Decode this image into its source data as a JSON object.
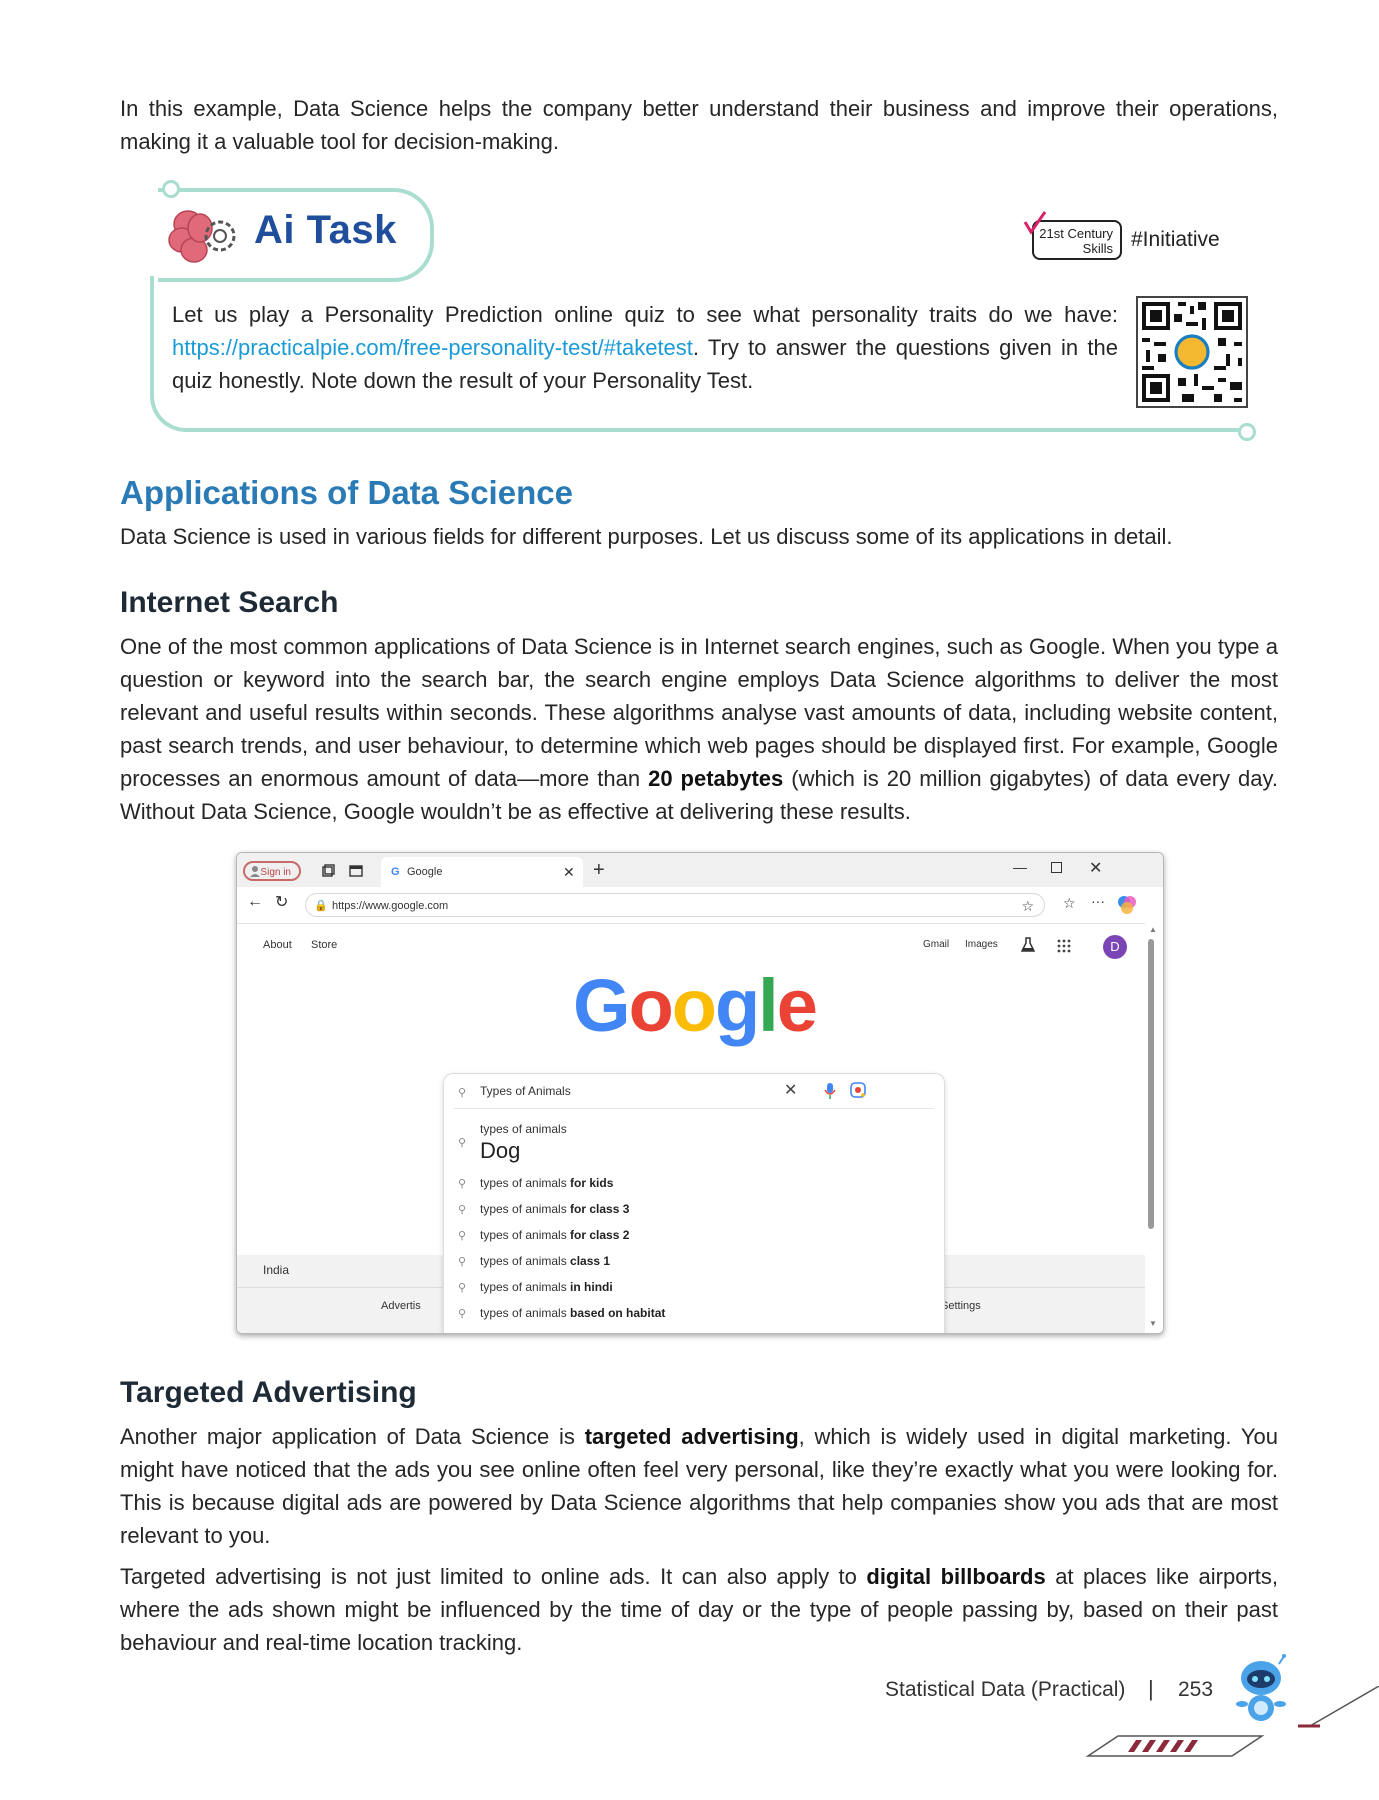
{
  "intro": {
    "text": "In this example, Data Science helps the company better understand their business and improve their operations, making it a valuable tool for decision-making."
  },
  "ai_task": {
    "title": "Ai Task",
    "badge_line1": "21st Century",
    "badge_line2": "Skills",
    "initiative": "#Initiative",
    "text_before": "Let us play a Personality Prediction online quiz to see what personality traits do we have: ",
    "link": "https://practicalpie.com/free-personality-test/#taketest",
    "text_after": ". Try to answer the questions given in the quiz honestly. Note down the result of your Personality Test."
  },
  "applications": {
    "heading": "Applications of Data Science",
    "text": "Data Science is used in various fields for different purposes. Let us discuss some of its applications in detail."
  },
  "internet_search": {
    "heading": "Internet Search",
    "text_1": "One of the most common applications of Data Science is in Internet search engines, such as Google. When you type a question or keyword into the search bar, the search engine employs Data Science algorithms to deliver the most relevant and useful results within seconds. These algorithms analyse vast amounts of data, including website content, past search trends, and user behaviour, to determine which web pages should be displayed first. For example, Google processes an enormous amount of data—more than ",
    "bold": "20 petabytes",
    "text_2": " (which is 20 million gigabytes) of data every day. Without Data Science, Google wouldn’t be as effective at delivering these results."
  },
  "browser": {
    "sign_in": "Sign in",
    "tab_title": "Google",
    "url": "https://www.google.com",
    "nav_about": "About",
    "nav_store": "Store",
    "nav_gmail": "Gmail",
    "nav_images": "Images",
    "avatar": "D",
    "search_value": "Types of Animals",
    "first_sug_small": "types of animals",
    "first_sug_big": "Dog",
    "suggestions": [
      {
        "base": "types of animals ",
        "bold": "for kids"
      },
      {
        "base": "types of animals ",
        "bold": "for class 3"
      },
      {
        "base": "types of animals ",
        "bold": "for class 2"
      },
      {
        "base": "types of animals ",
        "bold": "class 1"
      },
      {
        "base": "types of animals ",
        "bold": "in hindi"
      },
      {
        "base": "types of animals ",
        "bold": "based on habitat"
      }
    ],
    "country": "India",
    "footer_left": "Advertis",
    "footer_right": "Settings"
  },
  "targeted_advertising": {
    "heading": "Targeted Advertising",
    "p1_a": "Another major application of Data Science is ",
    "p1_bold": "targeted advertising",
    "p1_b": ", which is widely used in digital marketing. You might have noticed that the ads you see online often feel very personal, like they’re exactly what you were looking for. This is because digital ads are powered by Data Science algorithms that help companies show you ads that are most relevant to you.",
    "p2_a": "Targeted advertising is not just limited to online ads. It can also apply to ",
    "p2_bold": "digital billboards",
    "p2_b": " at places like airports, where the ads shown might be influenced by the time of day or the type of people passing by, based on their past behaviour and real-time location tracking."
  },
  "footer": {
    "chapter": "Statistical Data (Practical)",
    "separator": "|",
    "page": "253"
  }
}
